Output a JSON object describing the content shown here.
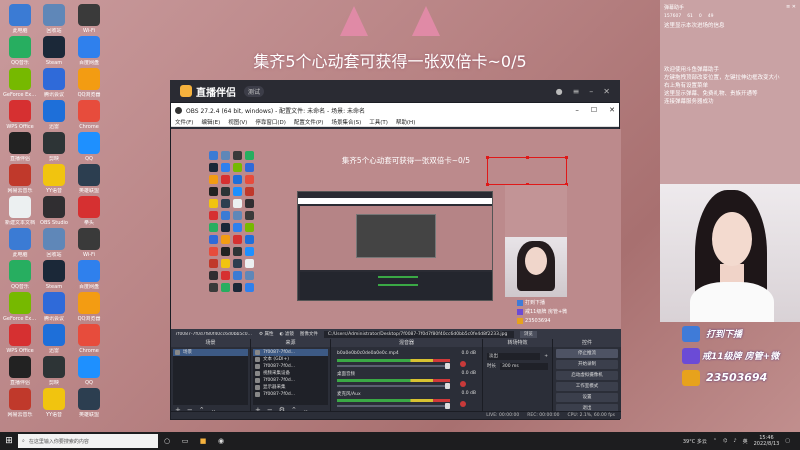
{
  "desktop": {
    "icons": [
      {
        "label": "此电脑",
        "color": "#3b7bd4"
      },
      {
        "label": "回收站",
        "color": "#5f87b8"
      },
      {
        "label": "Wi-Fi",
        "color": "#3a3a3a"
      },
      {
        "label": "QQ音乐",
        "color": "#27ae60"
      },
      {
        "label": "Steam",
        "color": "#1b2838"
      },
      {
        "label": "百度网盘",
        "color": "#2f80ed"
      },
      {
        "label": "GeForce Experience",
        "color": "#76b900"
      },
      {
        "label": "腾讯会议",
        "color": "#2f6ad9"
      },
      {
        "label": "QQ浏览器",
        "color": "#f39c12"
      },
      {
        "label": "WPS Office",
        "color": "#d63031"
      },
      {
        "label": "迅雷",
        "color": "#1e6fd9"
      },
      {
        "label": "Chrome",
        "color": "#e74c3c"
      },
      {
        "label": "直播伴侣",
        "color": "#222222"
      },
      {
        "label": "剪映",
        "color": "#2d3436"
      },
      {
        "label": "QQ",
        "color": "#1e90ff"
      },
      {
        "label": "网易云音乐",
        "color": "#c0392b"
      },
      {
        "label": "YY语音",
        "color": "#f1c40f"
      },
      {
        "label": "英雄联盟",
        "color": "#2c3e50"
      },
      {
        "label": "新建文本文档",
        "color": "#ecf0f1"
      },
      {
        "label": "OBS Studio",
        "color": "#302e31"
      },
      {
        "label": "拳头",
        "color": "#d63031"
      }
    ]
  },
  "headline": "集齐5个心动套可获得一张双倍卡~0/5",
  "banner": {
    "app_name": "直播伴侣",
    "version": "测试"
  },
  "obs": {
    "title": "OBS 27.2.4 (64 bit, windows) - 配置文件: 未命名 - 场景: 未命名",
    "menu": [
      "文件(F)",
      "编辑(E)",
      "视图(V)",
      "停靠窗口(D)",
      "配置文件(P)",
      "场景集合(S)",
      "工具(T)",
      "帮助(H)"
    ],
    "source_path": "C:/Users/Administrator/Desktop/7f0087-7f0d7f80f40cc6d0bb5c0fe4d8f2233.jpg",
    "source_label": "7f0087-7f0d7f80f40cc6d0bb5c0...",
    "props_btn": "属性",
    "filter_btn": "滤镜",
    "image_file_label": "图像文件",
    "browse_btn": "浏览",
    "docks": {
      "scenes": {
        "title": "场景",
        "items": [
          "场景"
        ]
      },
      "sources": {
        "title": "来源",
        "items": [
          "7f0087-7f0d...",
          "文本 (GDI+)",
          "7f0087-7f0d...",
          "视频采集设备",
          "7f0087-7f0d...",
          "显示器采集",
          "7f0087-7f0d..."
        ]
      },
      "mixer": {
        "title": "混音器",
        "items": [
          {
            "name": "b0a0e0b0c0de0a0e0c.mp4",
            "db": "0.0 dB"
          },
          {
            "name": "桌面音频",
            "db": "0.0 dB"
          },
          {
            "name": "麦克风/Aux",
            "db": "0.0 dB"
          }
        ]
      },
      "transitions": {
        "title": "转场特效",
        "type": "淡出",
        "duration_label": "时长",
        "duration": "300 ms"
      },
      "controls": {
        "title": "控件",
        "buttons": [
          "停止推流",
          "开始录制",
          "启动虚拟摄像机",
          "工作室模式",
          "设置",
          "退出"
        ]
      }
    },
    "status": {
      "live": "LIVE: 00:00:00",
      "rec": "REC: 00:00:00",
      "cpu": "CPU: 2.1%, 60.00 fps"
    }
  },
  "right_panel": {
    "title": "弹幕助手",
    "stats": [
      "157607",
      "61",
      "0",
      "49"
    ],
    "messages": [
      "这里显示本次进场的信息",
      "欢迎使用斗鱼弹幕助手",
      "左键拖拽顶部改变位置，左键拉伸边框改变大小",
      "右上角有设置菜单",
      "这里显示弹幕、免费礼物、贵族开通等",
      "连接弹幕服务器成功"
    ]
  },
  "badges": [
    {
      "text": "打到下播",
      "color": "#3f7bd8"
    },
    {
      "text": "戒11级牌 房管+微",
      "color": "#6b4bd6"
    },
    {
      "text": "23503694",
      "color": "#e7a21c"
    }
  ],
  "taskbar": {
    "search_placeholder": "在这里输入你要搜索的内容",
    "weather": "39°C 多云",
    "ime": "英",
    "time": "15:46",
    "date": "2022/8/13"
  }
}
